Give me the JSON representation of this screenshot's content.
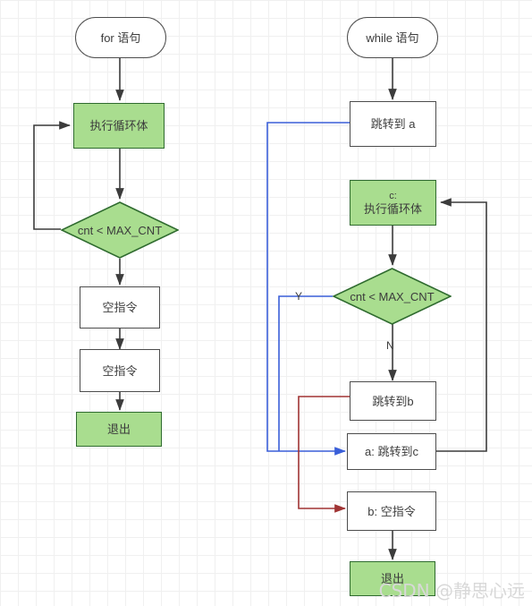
{
  "diagram": {
    "title_left": "for 语句",
    "title_right": "while 语句",
    "watermark": "CSDN @静思心远",
    "colors": {
      "green_fill": "#a9dd8f",
      "green_stroke": "#2f6b2f",
      "box_stroke": "#4d4d4d",
      "blue_edge": "#5b6ee0",
      "red_edge": "#a54a4a",
      "grid": "#f0f0f0"
    }
  },
  "left_flow": {
    "nodes": [
      {
        "id": "for-start",
        "label": "for 语句",
        "shape": "rounded"
      },
      {
        "id": "for-body",
        "label": "执行循环体",
        "shape": "green-process"
      },
      {
        "id": "for-cond",
        "label": "cnt < MAX_CNT",
        "shape": "diamond"
      },
      {
        "id": "for-nop-1",
        "label": "空指令",
        "shape": "process"
      },
      {
        "id": "for-nop-2",
        "label": "空指令",
        "shape": "process"
      },
      {
        "id": "for-exit",
        "label": "退出",
        "shape": "green-process"
      }
    ]
  },
  "right_flow": {
    "nodes": [
      {
        "id": "while-start",
        "label": "while 语句",
        "shape": "rounded"
      },
      {
        "id": "jump-a",
        "label": "跳转到 a",
        "shape": "process"
      },
      {
        "id": "c-body",
        "label_top": "c:",
        "label_main": "执行循环体",
        "shape": "green-process"
      },
      {
        "id": "while-cond",
        "label": "cnt < MAX_CNT",
        "shape": "diamond"
      },
      {
        "id": "jump-b",
        "label": "跳转到b",
        "shape": "process"
      },
      {
        "id": "label-a",
        "label": "a: 跳转到c",
        "shape": "process"
      },
      {
        "id": "label-b",
        "label": "b: 空指令",
        "shape": "process"
      },
      {
        "id": "while-exit",
        "label": "退出",
        "shape": "green-process"
      }
    ],
    "edge_labels": {
      "yes": "Y",
      "no": "N"
    }
  }
}
